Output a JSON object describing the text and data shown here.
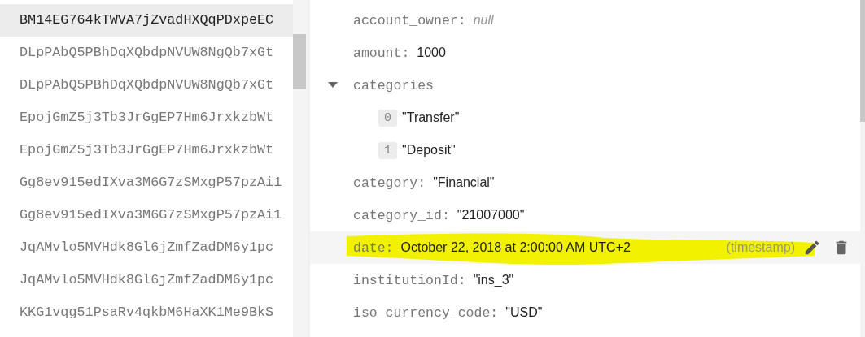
{
  "documents": [
    {
      "id": "BM14EG764kTWVA7jZvadHXQqPDxpeEC",
      "selected": true
    },
    {
      "id": "DLpPAbQ5PBhDqXQbdpNVUW8NgQb7xGt",
      "selected": false
    },
    {
      "id": "DLpPAbQ5PBhDqXQbdpNVUW8NgQb7xGt",
      "selected": false
    },
    {
      "id": "EpojGmZ5j3Tb3JrGgEP7Hm6JrxkzbWt",
      "selected": false
    },
    {
      "id": "EpojGmZ5j3Tb3JrGgEP7Hm6JrxkzbWt",
      "selected": false
    },
    {
      "id": "Gg8ev915edIXva3M6G7zSMxgP57pzAi1",
      "selected": false
    },
    {
      "id": "Gg8ev915edIXva3M6G7zSMxgP57pzAi1",
      "selected": false
    },
    {
      "id": "JqAMvlo5MVHdk8Gl6jZmfZadDM6y1pc",
      "selected": false
    },
    {
      "id": "JqAMvlo5MVHdk8Gl6jZmfZadDM6y1pc",
      "selected": false
    },
    {
      "id": "KKG1vqg51PsaRv4qkbM6HaXK1Me9BkS",
      "selected": false
    }
  ],
  "fields": [
    {
      "kind": "null",
      "key": "account_owner:",
      "value": "null"
    },
    {
      "kind": "value",
      "key": "amount:",
      "value": "1000"
    },
    {
      "kind": "array",
      "key": "categories",
      "expanded": true,
      "children": [
        {
          "index": "0",
          "value": "\"Transfer\""
        },
        {
          "index": "1",
          "value": "\"Deposit\""
        }
      ]
    },
    {
      "kind": "value",
      "key": "category:",
      "value": "\"Financial\""
    },
    {
      "kind": "value",
      "key": "category_id:",
      "value": "\"21007000\""
    },
    {
      "kind": "value",
      "key": "date:",
      "value": "October 22, 2018 at 2:00:00 AM UTC+2",
      "type": "(timestamp)",
      "hovered": true,
      "highlighted": true
    },
    {
      "kind": "value",
      "key": "institutionId:",
      "value": "\"ins_3\""
    },
    {
      "kind": "value",
      "key": "iso_currency_code:",
      "value": "\"USD\""
    }
  ]
}
